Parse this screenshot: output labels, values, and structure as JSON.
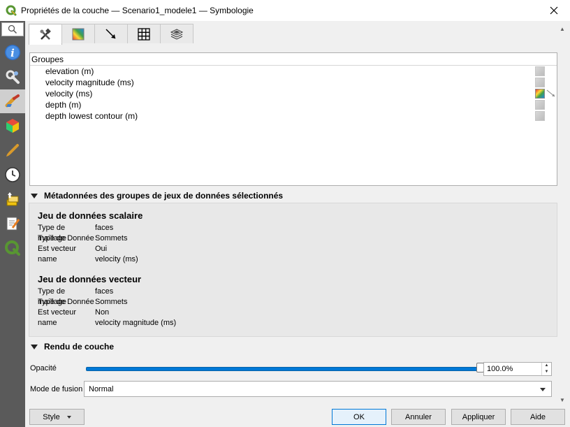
{
  "window": {
    "title": "Propriétés de la couche — Scenario1_modele1 — Symbologie",
    "close_icon": "close-icon"
  },
  "sidebar": {
    "search_icon": "search-icon",
    "items": [
      {
        "name": "information",
        "icon": "info-icon"
      },
      {
        "name": "source",
        "icon": "wrench-icon"
      },
      {
        "name": "symbology",
        "icon": "paintbrush-icon",
        "active": true
      },
      {
        "name": "3d-view",
        "icon": "cube-icon"
      },
      {
        "name": "rendering",
        "icon": "brush-icon"
      },
      {
        "name": "temporal",
        "icon": "clock-icon"
      },
      {
        "name": "dataset",
        "icon": "layers-up-icon"
      },
      {
        "name": "metadata",
        "icon": "notepad-icon"
      },
      {
        "name": "qgis",
        "icon": "qgis-icon"
      }
    ]
  },
  "tabs": [
    {
      "name": "general",
      "icon": "tools-icon",
      "active": true
    },
    {
      "name": "contours",
      "icon": "rainbow-icon"
    },
    {
      "name": "vectors",
      "icon": "arrow-icon"
    },
    {
      "name": "mesh",
      "icon": "grid-icon"
    },
    {
      "name": "3d",
      "icon": "stack-icon"
    }
  ],
  "groups": {
    "header": "Groupes",
    "items": [
      {
        "label": "elevation (m)",
        "swatch": "none"
      },
      {
        "label": "velocity magnitude (ms)",
        "swatch": "none"
      },
      {
        "label": "velocity (ms)",
        "swatch": "rainbow",
        "vector": true
      },
      {
        "label": "depth (m)",
        "swatch": "none"
      },
      {
        "label": "depth lowest contour (m)",
        "swatch": "none"
      }
    ]
  },
  "metadata": {
    "header": "Métadonnées des groupes de jeux de données sélectionnés",
    "scalar": {
      "title": "Jeu de données scalaire",
      "rows": [
        {
          "k": "Type de maillage",
          "v": "faces"
        },
        {
          "k": "Type de Donnée",
          "v": "Sommets"
        },
        {
          "k": "Est vecteur",
          "v": "Oui"
        },
        {
          "k": "name",
          "v": "velocity (ms)"
        }
      ]
    },
    "vector": {
      "title": "Jeu de données vecteur",
      "rows": [
        {
          "k": "Type de maillage",
          "v": "faces"
        },
        {
          "k": "Type de Donnée",
          "v": "Sommets"
        },
        {
          "k": "Est vecteur",
          "v": "Non"
        },
        {
          "k": "name",
          "v": "velocity magnitude (ms)"
        }
      ]
    }
  },
  "rendu": {
    "header": "Rendu de couche",
    "opacity_label": "Opacité",
    "opacity_value": "100.0%",
    "opacity_level": 1.0,
    "blend_label": "Mode de fusion",
    "blend_value": "Normal"
  },
  "footer": {
    "style": "Style",
    "ok": "OK",
    "cancel": "Annuler",
    "apply": "Appliquer",
    "help": "Aide"
  },
  "colors": {
    "accent": "#0078d7",
    "sidebar_bg": "#5a5a5a",
    "qgis_green": "#589632"
  }
}
